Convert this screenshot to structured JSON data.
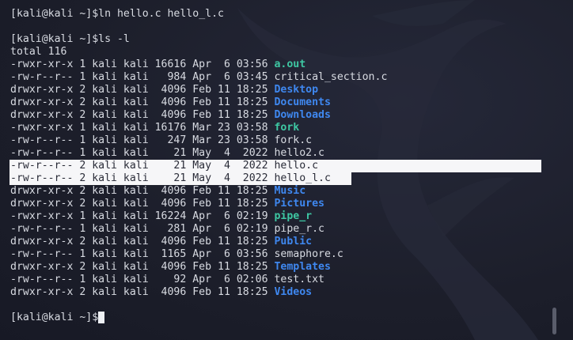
{
  "terminal": {
    "prompt": "[kali@kali ~]$",
    "history": [
      {
        "prompt": "[kali@kali ~]$",
        "command": "ln hello.c hello_l.c"
      }
    ],
    "ls_command": {
      "prompt": "[kali@kali ~]$",
      "command": "ls -l"
    },
    "total": "total 116",
    "listing": [
      {
        "meta": "-rwxr-xr-x 1 kali kali 16616 Apr  6 03:56 ",
        "name": "a.out",
        "kind": "exe"
      },
      {
        "meta": "-rw-r--r-- 1 kali kali   984 Apr  6 03:45 ",
        "name": "critical_section.c",
        "kind": "file"
      },
      {
        "meta": "drwxr-xr-x 2 kali kali  4096 Feb 11 18:25 ",
        "name": "Desktop",
        "kind": "dir"
      },
      {
        "meta": "drwxr-xr-x 2 kali kali  4096 Feb 11 18:25 ",
        "name": "Documents",
        "kind": "dir"
      },
      {
        "meta": "drwxr-xr-x 2 kali kali  4096 Feb 11 18:25 ",
        "name": "Downloads",
        "kind": "dir"
      },
      {
        "meta": "-rwxr-xr-x 1 kali kali 16176 Mar 23 03:58 ",
        "name": "fork",
        "kind": "exe"
      },
      {
        "meta": "-rw-r--r-- 1 kali kali   247 Mar 23 03:58 ",
        "name": "fork.c",
        "kind": "file"
      },
      {
        "meta": "-rw-r--r-- 1 kali kali    21 May  4  2022 ",
        "name": "hello2.c",
        "kind": "file"
      },
      {
        "meta": "-rw-r--r-- 2 kali kali    21 May  4  2022 ",
        "name": "hello.c",
        "kind": "file",
        "selected": "long"
      },
      {
        "meta": "-rw-r--r-- 2 kali kali    21 May  4  2022 ",
        "name": "hello_l.c",
        "kind": "file",
        "selected": "short"
      },
      {
        "meta": "drwxr-xr-x 2 kali kali  4096 Feb 11 18:25 ",
        "name": "Music",
        "kind": "dir"
      },
      {
        "meta": "drwxr-xr-x 2 kali kali  4096 Feb 11 18:25 ",
        "name": "Pictures",
        "kind": "dir"
      },
      {
        "meta": "-rwxr-xr-x 1 kali kali 16224 Apr  6 02:19 ",
        "name": "pipe_r",
        "kind": "exe"
      },
      {
        "meta": "-rw-r--r-- 1 kali kali   281 Apr  6 02:19 ",
        "name": "pipe_r.c",
        "kind": "file"
      },
      {
        "meta": "drwxr-xr-x 2 kali kali  4096 Feb 11 18:25 ",
        "name": "Public",
        "kind": "dir"
      },
      {
        "meta": "-rw-r--r-- 1 kali kali  1165 Apr  6 03:56 ",
        "name": "semaphore.c",
        "kind": "file"
      },
      {
        "meta": "drwxr-xr-x 2 kali kali  4096 Feb 11 18:25 ",
        "name": "Templates",
        "kind": "dir"
      },
      {
        "meta": "-rw-r--r-- 1 kali kali    92 Apr  6 02:06 ",
        "name": "test.txt",
        "kind": "file"
      },
      {
        "meta": "drwxr-xr-x 2 kali kali  4096 Feb 11 18:25 ",
        "name": "Videos",
        "kind": "dir"
      }
    ],
    "current_prompt": "[kali@kali ~]$",
    "current_input": ""
  },
  "colors": {
    "background": "#1d1f2c",
    "text": "#d8dbe2",
    "directory": "#3f88f0",
    "executable": "#3ec7a3",
    "selection": "#f6f6f8"
  },
  "icons": {
    "background_logo": "kali-dragon-icon"
  }
}
